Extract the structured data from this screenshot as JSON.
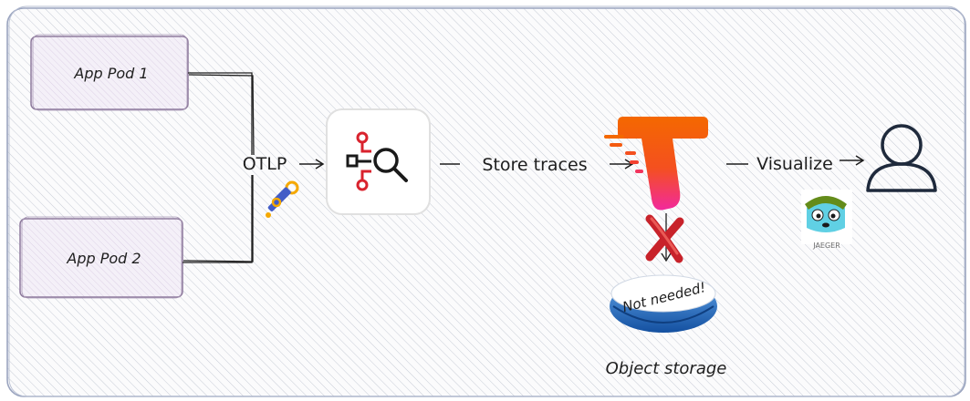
{
  "nodes": {
    "pod1": "App Pod 1",
    "pod2": "App Pod 2",
    "storage_badge": "Not needed!",
    "storage_caption": "Object storage",
    "jaeger_caption": "JAEGER"
  },
  "edges": {
    "otlp": "OTLP",
    "store": "Store traces",
    "visualize": "Visualize"
  },
  "icons": [
    "otel-collector-icon",
    "opentelemetry-logo-icon",
    "tempo-logo-icon",
    "red-x-icon",
    "object-storage-disk-icon",
    "user-icon",
    "jaeger-logo-icon"
  ],
  "colors": {
    "pod_fill": "#f0ecf6",
    "pod_stroke": "#8e7a9d",
    "collector_red": "#d9232e",
    "tempo_top": "#f46800",
    "tempo_bottom": "#f2299d",
    "x_red": "#c8222a",
    "disk_blue": "#1e6fc7"
  }
}
